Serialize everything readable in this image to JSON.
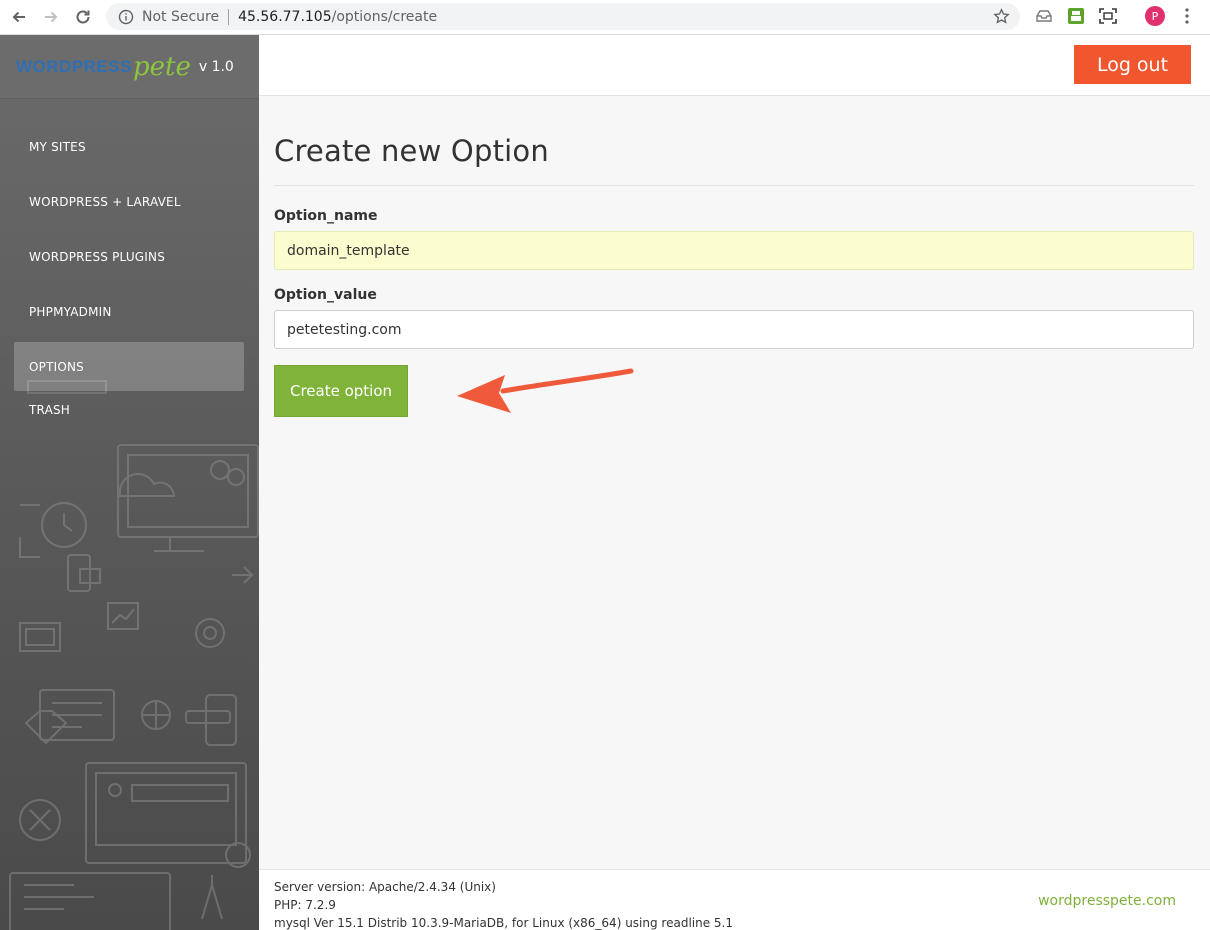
{
  "browser": {
    "security_label": "Not Secure",
    "url_host": "45.56.77.105",
    "url_path": "/options/create",
    "profile_initial": "P"
  },
  "brand": {
    "word": "WORDPRESS",
    "pete": "pete",
    "version": "v 1.0"
  },
  "sidebar": {
    "items": [
      {
        "label": "MY SITES",
        "active": false
      },
      {
        "label": "WORDPRESS + LARAVEL",
        "active": false
      },
      {
        "label": "WORDPRESS PLUGINS",
        "active": false
      },
      {
        "label": "PHPMYADMIN",
        "active": false
      },
      {
        "label": "OPTIONS",
        "active": true
      },
      {
        "label": "TRASH",
        "active": false
      }
    ]
  },
  "header": {
    "logout_label": "Log out"
  },
  "form": {
    "title": "Create new Option",
    "option_name_label": "Option_name",
    "option_name_value": "domain_template",
    "option_value_label": "Option_value",
    "option_value_value": "petetesting.com",
    "submit_label": "Create option"
  },
  "footer": {
    "server_version": "Server version: Apache/2.4.34 (Unix)",
    "php_version": "PHP: 7.2.9",
    "mysql_version": "mysql Ver 15.1 Distrib 10.3.9-MariaDB, for Linux (x86_64) using readline 5.1",
    "site_link": "wordpresspete.com"
  },
  "colors": {
    "accent_orange": "#f1562e",
    "accent_green": "#80b33a",
    "sidebar_gray": "#5a5a5a",
    "autofill_yellow": "#fbfdce"
  }
}
